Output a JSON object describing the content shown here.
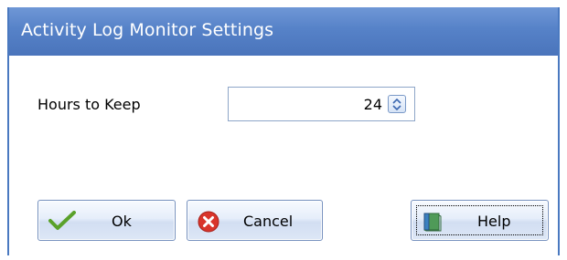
{
  "window": {
    "title": "Activity Log Monitor Settings"
  },
  "form": {
    "hours_label": "Hours to Keep",
    "hours_value": "24"
  },
  "buttons": {
    "ok_label": "Ok",
    "cancel_label": "Cancel",
    "help_label": "Help"
  },
  "icons": {
    "ok": "checkmark-icon",
    "cancel": "cancel-x-icon",
    "help": "help-book-icon",
    "spin": "up-down-spin-icon"
  },
  "colors": {
    "title_bar": "#5682c8",
    "title_text": "#ffffff",
    "check_green": "#5aa12a",
    "cancel_red": "#d9352b"
  }
}
